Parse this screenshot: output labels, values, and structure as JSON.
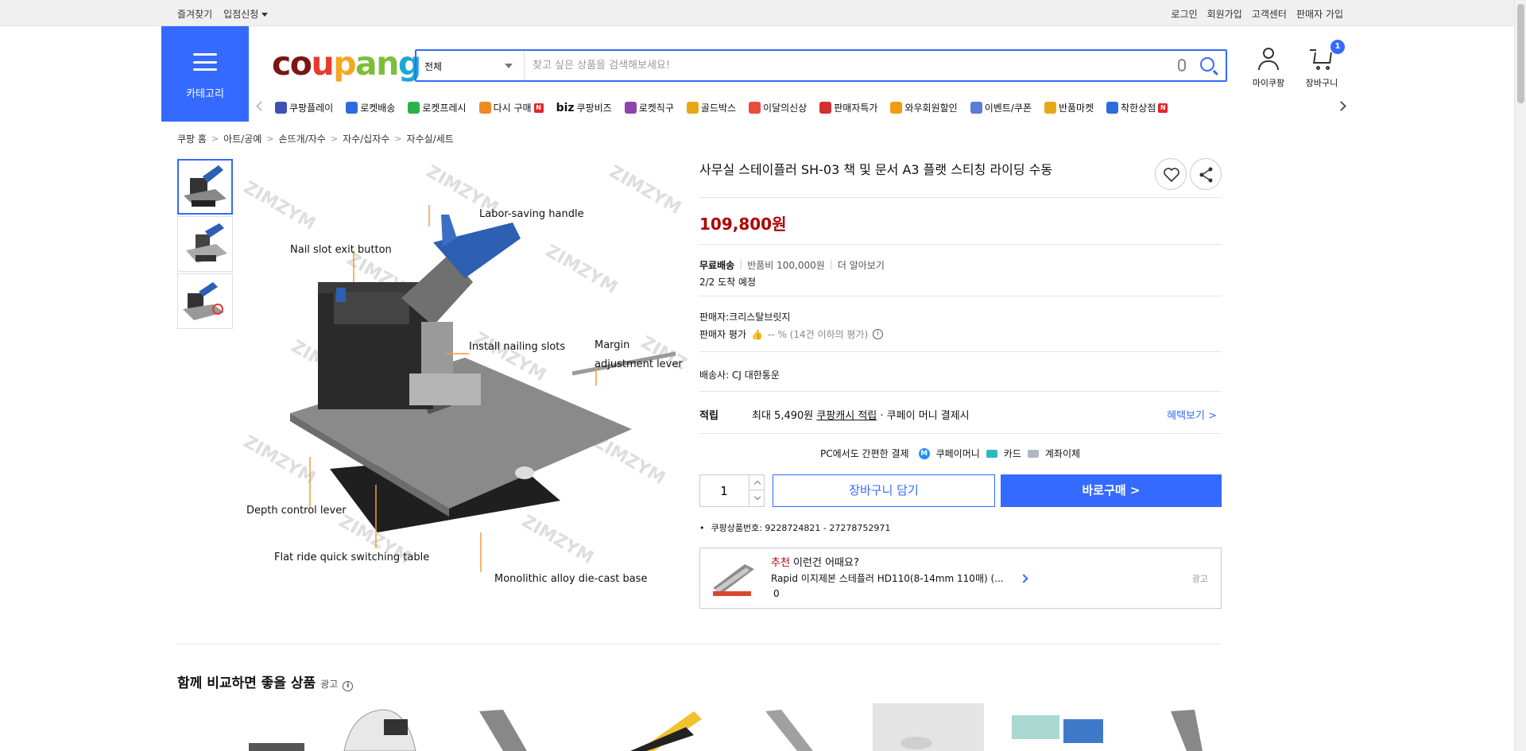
{
  "topbar": {
    "left": [
      "즐겨찾기",
      "입점신청"
    ],
    "right": [
      "로그인",
      "회원가입",
      "고객센터",
      "판매자 가입"
    ]
  },
  "header": {
    "category_label": "카테고리",
    "logo": [
      "co",
      "u",
      "p",
      "an",
      "g"
    ],
    "search_category": "전체",
    "search_placeholder": "찾고 싶은 상품을 검색해보세요!",
    "my_coupang": "마이쿠팡",
    "cart_label": "장바구니",
    "cart_count": "1"
  },
  "nav": {
    "items": [
      {
        "label": "쿠팡플레이",
        "icon": "play-icon",
        "color": "#3f51b5"
      },
      {
        "label": "로켓배송",
        "icon": "rocket-icon",
        "color": "#2d6cdf"
      },
      {
        "label": "로켓프레시",
        "icon": "rocket-fresh-icon",
        "color": "#2bb24c"
      },
      {
        "label": "다시 구매",
        "icon": "rebuy-icon",
        "color": "#f08a24"
      },
      {
        "label": "쿠팡비즈",
        "prefix": "biz",
        "icon": "biz-icon",
        "color": ""
      },
      {
        "label": "로켓직구",
        "icon": "global-icon",
        "color": "#8e44ad"
      },
      {
        "label": "골드박스",
        "icon": "goldbox-icon",
        "color": "#e6a817"
      },
      {
        "label": "이달의신상",
        "icon": "new-icon",
        "color": "#e84c3d"
      },
      {
        "label": "판매자특가",
        "icon": "seller-deal-icon",
        "color": "#d32f2f"
      },
      {
        "label": "와우회원할인",
        "icon": "wow-icon",
        "color": "#f39c12"
      },
      {
        "label": "이벤트/쿠폰",
        "icon": "coupon-icon",
        "color": "#5b7bd5"
      },
      {
        "label": "반품마켓",
        "icon": "return-market-icon",
        "color": "#e6a817"
      },
      {
        "label": "착한상점",
        "icon": "good-store-icon",
        "color": "#2d6cdf"
      }
    ],
    "new_badge": "N"
  },
  "breadcrumb": [
    "쿠팡 홈",
    "아트/공예",
    "손뜨개/자수",
    "자수/십자수",
    "자수실/세트"
  ],
  "image_labels": {
    "handle": "Labor-saving handle",
    "exit": "Nail slot exit button",
    "install": "Install nailing slots",
    "margin1": "Margin",
    "margin2": "adjustment lever",
    "depth": "Depth control lever",
    "flat": "Flat ride quick switching table",
    "base": "Monolithic alloy die-cast base",
    "watermark": "ZIMZYM"
  },
  "product": {
    "title": "사무실 스테이플러 SH-03 책 및 문서 A3 플랫 스티칭 라이딩 수동",
    "price": "109,800원",
    "ship_free": "무료배송",
    "ship_return": "반품비 100,000원",
    "ship_more": "더 알아보기",
    "eta": "2/2 도착 예정",
    "seller": "판매자:크리스탈브릿지",
    "rating_label": "판매자 평가",
    "rating_value": "-- % (14건 이하의 평가)",
    "carrier": "배송사:  CJ 대한통운",
    "reward_label": "적립",
    "reward_prefix": "최대 5,490원 ",
    "reward_link": "쿠팡캐시 적립",
    "reward_suffix": " · 쿠페이 머니 결제시",
    "reward_more": "혜택보기 >",
    "pay_title": "PC에서도 간편한 결제",
    "pay_money": "쿠페이머니",
    "pay_card": "카드",
    "pay_bank": "계좌이체",
    "quantity": "1",
    "add_cart": "장바구니 담기",
    "buy_now": "바로구매 >",
    "product_id": "쿠팡상품번호: 9228724821 - 27278752971"
  },
  "recommend": {
    "highlight": "추천",
    "heading": " 이런건 어때요?",
    "name": "Rapid 이지제본 스테플러 HD110(8-14mm 110매) (...",
    "price": "0",
    "ad": "광고"
  },
  "section": {
    "title": "함께 비교하면 좋을 상품",
    "ad": "광고"
  },
  "colors": {
    "accent": "#346aff",
    "price": "#ae0000"
  }
}
